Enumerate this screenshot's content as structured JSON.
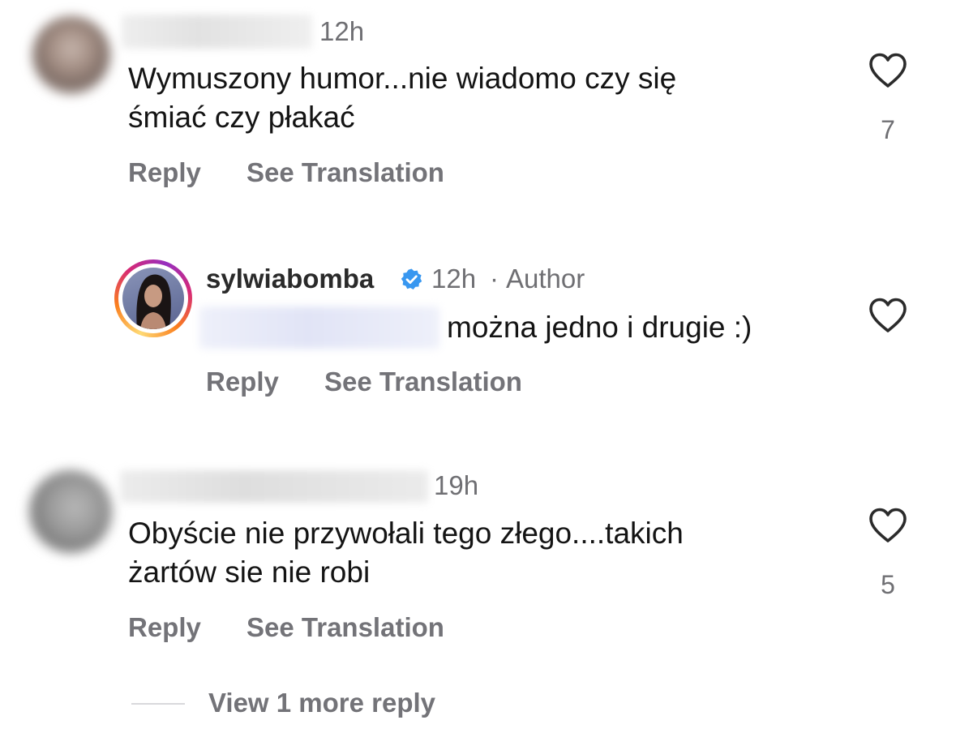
{
  "comments": [
    {
      "time": "12h",
      "text_lines": [
        "Wymuszony humor...nie wiadomo czy się",
        "śmiać czy płakać"
      ],
      "reply_label": "Reply",
      "translate_label": "See Translation",
      "like_count": "7"
    },
    {
      "username": "sylwiabomba",
      "time": "12h",
      "separator": "·",
      "author_label": "Author",
      "text": "można jedno i drugie :)",
      "reply_label": "Reply",
      "translate_label": "See Translation"
    },
    {
      "time": "19h",
      "text_lines": [
        "Obyście nie przywołali tego złego....takich",
        "żartów sie nie robi"
      ],
      "reply_label": "Reply",
      "translate_label": "See Translation",
      "like_count": "5"
    }
  ],
  "view_more_replies_label": "View 1 more reply",
  "colors": {
    "verified_badge": "#3897f0",
    "secondary_text": "#737378",
    "primary_text": "#141414"
  },
  "icons": {
    "like": "heart-outline-icon",
    "verified": "verified-badge-icon"
  }
}
